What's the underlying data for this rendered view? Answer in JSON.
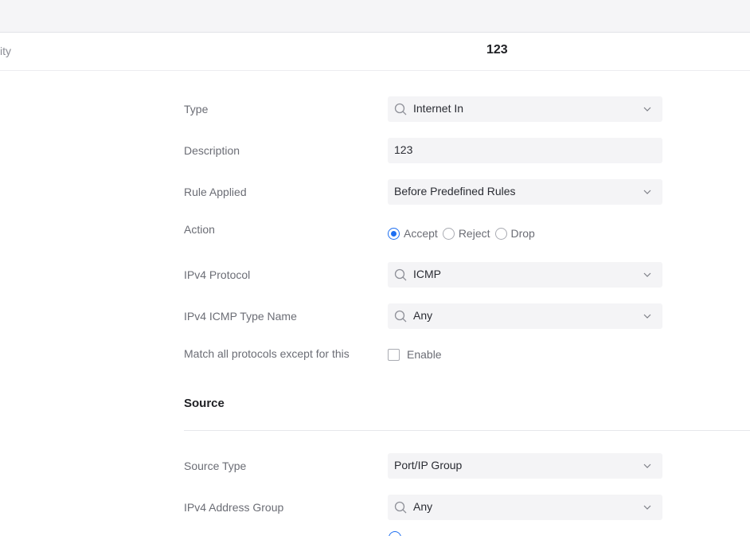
{
  "header": {
    "left_text": "ity",
    "title": "123"
  },
  "form": {
    "type": {
      "label": "Type",
      "value": "Internet In"
    },
    "description": {
      "label": "Description",
      "value": "123"
    },
    "rule_applied": {
      "label": "Rule Applied",
      "value": "Before Predefined Rules"
    },
    "action": {
      "label": "Action",
      "options": [
        "Accept",
        "Reject",
        "Drop"
      ],
      "selected": "Accept"
    },
    "ipv4_protocol": {
      "label": "IPv4 Protocol",
      "value": "ICMP"
    },
    "icmp_type": {
      "label": "IPv4 ICMP Type Name",
      "value": "Any"
    },
    "match_except": {
      "label": "Match all protocols except for this",
      "checkbox_label": "Enable",
      "checked": false
    }
  },
  "source": {
    "title": "Source",
    "source_type": {
      "label": "Source Type",
      "value": "Port/IP Group"
    },
    "address_group": {
      "label": "IPv4 Address Group",
      "value": "Any"
    }
  },
  "colors": {
    "accent": "#1e6ff1",
    "field_bg": "#f4f4f6",
    "topbar_bg": "#f5f5f7"
  },
  "icons": {
    "search": "search-icon",
    "dropdown": "chevron-down-icon"
  }
}
